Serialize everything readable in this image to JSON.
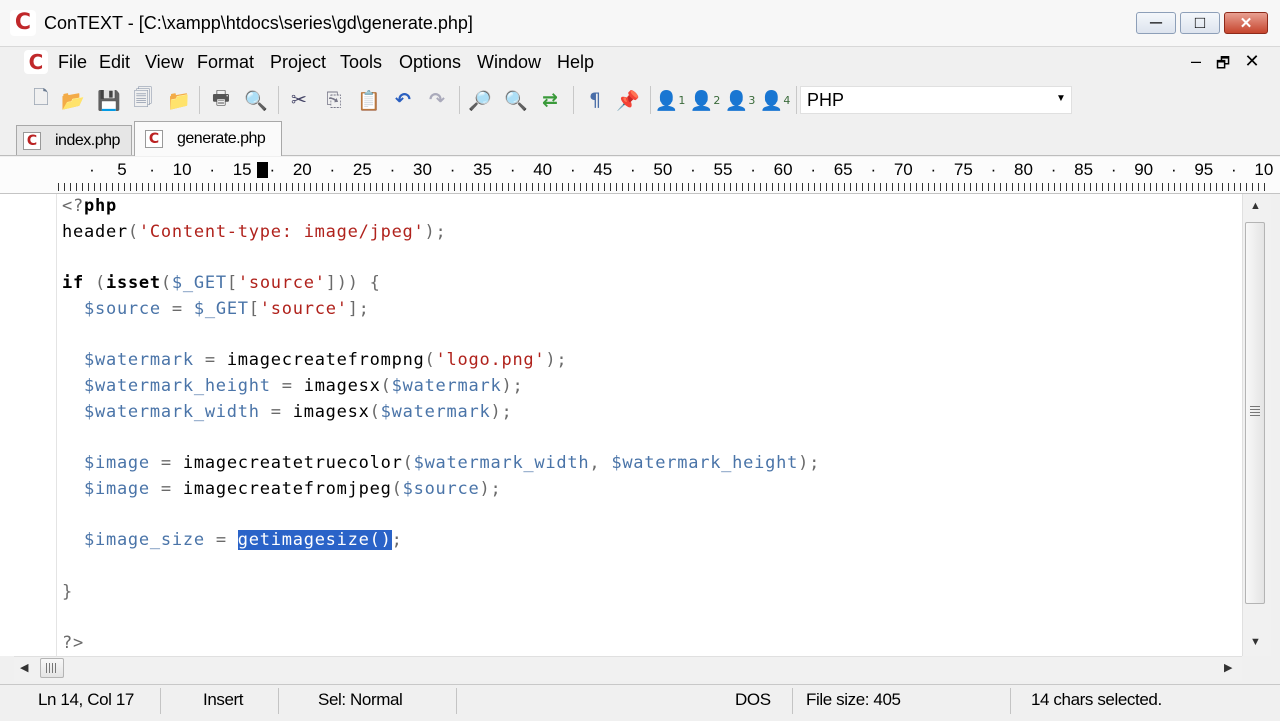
{
  "window": {
    "title": "ConTEXT - [C:\\xampp\\htdocs\\series\\gd\\generate.php]",
    "logo_letter": "C",
    "controls": {
      "minimize": "─",
      "maximize": "□",
      "close": "✕"
    }
  },
  "menu": {
    "items": [
      "File",
      "Edit",
      "View",
      "Format",
      "Project",
      "Tools",
      "Options",
      "Window",
      "Help"
    ],
    "mdi": {
      "minimize": "–",
      "restore": "🗗",
      "close": "✕"
    }
  },
  "toolbar": {
    "icons": [
      "new-file-icon",
      "open-folder-icon",
      "save-icon",
      "save-all-icon",
      "open-project-icon",
      "print-icon",
      "print-preview-icon",
      "cut-icon",
      "copy-icon",
      "paste-icon",
      "undo-icon",
      "redo-icon",
      "find-icon",
      "find-next-icon",
      "replace-icon",
      "wordwrap-icon",
      "pin-icon",
      "user-1-icon",
      "user-2-icon",
      "user-3-icon",
      "user-4-icon"
    ],
    "glyphs": [
      "🗋",
      "📂",
      "💾",
      "🗐",
      "📁",
      "🖶",
      "🔍",
      "✂",
      "⎘",
      "📋",
      "↶",
      "↷",
      "🔎",
      "🔍",
      "⇄",
      "¶",
      "📌",
      "👤",
      "👤",
      "👤",
      "👤"
    ],
    "user_subscripts": [
      "1",
      "2",
      "3",
      "4"
    ],
    "language": "PHP"
  },
  "tabs": [
    {
      "label": "index.php",
      "active": false
    },
    {
      "label": "generate.php",
      "active": true
    }
  ],
  "ruler": {
    "numbers": [
      "5",
      "10",
      "15",
      "20",
      "25",
      "30",
      "35",
      "40",
      "45",
      "50",
      "55",
      "60",
      "65",
      "70",
      "75",
      "80",
      "85",
      "90",
      "95",
      "10"
    ]
  },
  "editor": {
    "lines": [
      [
        [
          "pun",
          "<?"
        ],
        [
          "kw",
          "php"
        ]
      ],
      [
        [
          "fn",
          "header"
        ],
        [
          "pun",
          "("
        ],
        [
          "str",
          "'Content-type: image/jpeg'"
        ],
        [
          "pun",
          ");"
        ]
      ],
      [],
      [
        [
          "kw",
          "if"
        ],
        [
          "pun",
          " ("
        ],
        [
          "kw",
          "isset"
        ],
        [
          "pun",
          "("
        ],
        [
          "var",
          "$_GET"
        ],
        [
          "pun",
          "["
        ],
        [
          "str",
          "'source'"
        ],
        [
          "pun",
          "])) {"
        ]
      ],
      [
        [
          "pun",
          "  "
        ],
        [
          "var",
          "$source"
        ],
        [
          "pun",
          " = "
        ],
        [
          "var",
          "$_GET"
        ],
        [
          "pun",
          "["
        ],
        [
          "str",
          "'source'"
        ],
        [
          "pun",
          "];"
        ]
      ],
      [],
      [
        [
          "pun",
          "  "
        ],
        [
          "var",
          "$watermark"
        ],
        [
          "pun",
          " = "
        ],
        [
          "fn",
          "imagecreatefrompng"
        ],
        [
          "pun",
          "("
        ],
        [
          "str",
          "'logo.png'"
        ],
        [
          "pun",
          ");"
        ]
      ],
      [
        [
          "pun",
          "  "
        ],
        [
          "var",
          "$watermark_height"
        ],
        [
          "pun",
          " = "
        ],
        [
          "fn",
          "imagesx"
        ],
        [
          "pun",
          "("
        ],
        [
          "var",
          "$watermark"
        ],
        [
          "pun",
          ");"
        ]
      ],
      [
        [
          "pun",
          "  "
        ],
        [
          "var",
          "$watermark_width"
        ],
        [
          "pun",
          " = "
        ],
        [
          "fn",
          "imagesx"
        ],
        [
          "pun",
          "("
        ],
        [
          "var",
          "$watermark"
        ],
        [
          "pun",
          ");"
        ]
      ],
      [],
      [
        [
          "pun",
          "  "
        ],
        [
          "var",
          "$image"
        ],
        [
          "pun",
          " = "
        ],
        [
          "fn",
          "imagecreatetruecolor"
        ],
        [
          "pun",
          "("
        ],
        [
          "var",
          "$watermark_width"
        ],
        [
          "pun",
          ", "
        ],
        [
          "var",
          "$watermark_height"
        ],
        [
          "pun",
          ");"
        ]
      ],
      [
        [
          "pun",
          "  "
        ],
        [
          "var",
          "$image"
        ],
        [
          "pun",
          " = "
        ],
        [
          "fn",
          "imagecreatefromjpeg"
        ],
        [
          "pun",
          "("
        ],
        [
          "var",
          "$source"
        ],
        [
          "pun",
          ");"
        ]
      ],
      [],
      [
        [
          "pun",
          "  "
        ],
        [
          "var",
          "$image_size"
        ],
        [
          "pun",
          " = "
        ],
        [
          "sel",
          "getimagesize()"
        ],
        [
          "pun",
          ";"
        ]
      ],
      [],
      [
        [
          "pun",
          "}"
        ]
      ],
      [],
      [
        [
          "pun",
          "?>"
        ]
      ]
    ]
  },
  "statusbar": {
    "position": "Ln 14, Col 17",
    "mode": "Insert",
    "selection_mode": "Sel: Normal",
    "line_endings": "DOS",
    "file_size": "File size: 405",
    "selected": "14 chars selected."
  }
}
